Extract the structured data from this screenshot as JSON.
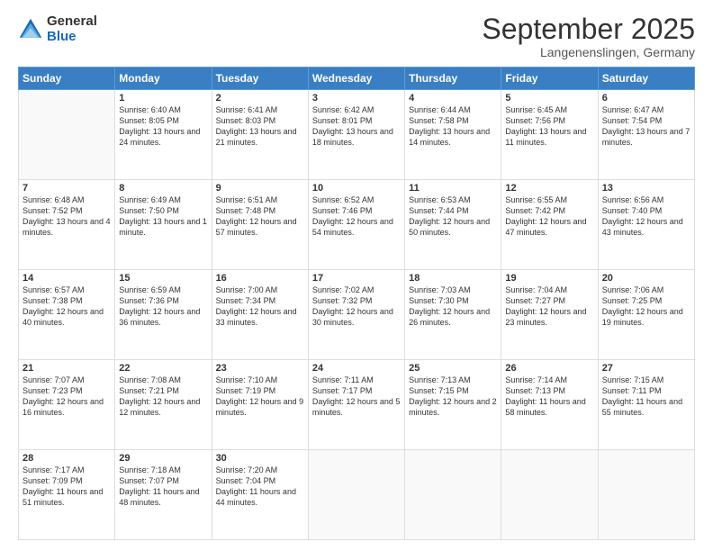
{
  "logo": {
    "general": "General",
    "blue": "Blue"
  },
  "title": "September 2025",
  "location": "Langenenslingen, Germany",
  "days_of_week": [
    "Sunday",
    "Monday",
    "Tuesday",
    "Wednesday",
    "Thursday",
    "Friday",
    "Saturday"
  ],
  "weeks": [
    [
      {
        "day": "",
        "sunrise": "",
        "sunset": "",
        "daylight": ""
      },
      {
        "day": "1",
        "sunrise": "Sunrise: 6:40 AM",
        "sunset": "Sunset: 8:05 PM",
        "daylight": "Daylight: 13 hours and 24 minutes."
      },
      {
        "day": "2",
        "sunrise": "Sunrise: 6:41 AM",
        "sunset": "Sunset: 8:03 PM",
        "daylight": "Daylight: 13 hours and 21 minutes."
      },
      {
        "day": "3",
        "sunrise": "Sunrise: 6:42 AM",
        "sunset": "Sunset: 8:01 PM",
        "daylight": "Daylight: 13 hours and 18 minutes."
      },
      {
        "day": "4",
        "sunrise": "Sunrise: 6:44 AM",
        "sunset": "Sunset: 7:58 PM",
        "daylight": "Daylight: 13 hours and 14 minutes."
      },
      {
        "day": "5",
        "sunrise": "Sunrise: 6:45 AM",
        "sunset": "Sunset: 7:56 PM",
        "daylight": "Daylight: 13 hours and 11 minutes."
      },
      {
        "day": "6",
        "sunrise": "Sunrise: 6:47 AM",
        "sunset": "Sunset: 7:54 PM",
        "daylight": "Daylight: 13 hours and 7 minutes."
      }
    ],
    [
      {
        "day": "7",
        "sunrise": "Sunrise: 6:48 AM",
        "sunset": "Sunset: 7:52 PM",
        "daylight": "Daylight: 13 hours and 4 minutes."
      },
      {
        "day": "8",
        "sunrise": "Sunrise: 6:49 AM",
        "sunset": "Sunset: 7:50 PM",
        "daylight": "Daylight: 13 hours and 1 minute."
      },
      {
        "day": "9",
        "sunrise": "Sunrise: 6:51 AM",
        "sunset": "Sunset: 7:48 PM",
        "daylight": "Daylight: 12 hours and 57 minutes."
      },
      {
        "day": "10",
        "sunrise": "Sunrise: 6:52 AM",
        "sunset": "Sunset: 7:46 PM",
        "daylight": "Daylight: 12 hours and 54 minutes."
      },
      {
        "day": "11",
        "sunrise": "Sunrise: 6:53 AM",
        "sunset": "Sunset: 7:44 PM",
        "daylight": "Daylight: 12 hours and 50 minutes."
      },
      {
        "day": "12",
        "sunrise": "Sunrise: 6:55 AM",
        "sunset": "Sunset: 7:42 PM",
        "daylight": "Daylight: 12 hours and 47 minutes."
      },
      {
        "day": "13",
        "sunrise": "Sunrise: 6:56 AM",
        "sunset": "Sunset: 7:40 PM",
        "daylight": "Daylight: 12 hours and 43 minutes."
      }
    ],
    [
      {
        "day": "14",
        "sunrise": "Sunrise: 6:57 AM",
        "sunset": "Sunset: 7:38 PM",
        "daylight": "Daylight: 12 hours and 40 minutes."
      },
      {
        "day": "15",
        "sunrise": "Sunrise: 6:59 AM",
        "sunset": "Sunset: 7:36 PM",
        "daylight": "Daylight: 12 hours and 36 minutes."
      },
      {
        "day": "16",
        "sunrise": "Sunrise: 7:00 AM",
        "sunset": "Sunset: 7:34 PM",
        "daylight": "Daylight: 12 hours and 33 minutes."
      },
      {
        "day": "17",
        "sunrise": "Sunrise: 7:02 AM",
        "sunset": "Sunset: 7:32 PM",
        "daylight": "Daylight: 12 hours and 30 minutes."
      },
      {
        "day": "18",
        "sunrise": "Sunrise: 7:03 AM",
        "sunset": "Sunset: 7:30 PM",
        "daylight": "Daylight: 12 hours and 26 minutes."
      },
      {
        "day": "19",
        "sunrise": "Sunrise: 7:04 AM",
        "sunset": "Sunset: 7:27 PM",
        "daylight": "Daylight: 12 hours and 23 minutes."
      },
      {
        "day": "20",
        "sunrise": "Sunrise: 7:06 AM",
        "sunset": "Sunset: 7:25 PM",
        "daylight": "Daylight: 12 hours and 19 minutes."
      }
    ],
    [
      {
        "day": "21",
        "sunrise": "Sunrise: 7:07 AM",
        "sunset": "Sunset: 7:23 PM",
        "daylight": "Daylight: 12 hours and 16 minutes."
      },
      {
        "day": "22",
        "sunrise": "Sunrise: 7:08 AM",
        "sunset": "Sunset: 7:21 PM",
        "daylight": "Daylight: 12 hours and 12 minutes."
      },
      {
        "day": "23",
        "sunrise": "Sunrise: 7:10 AM",
        "sunset": "Sunset: 7:19 PM",
        "daylight": "Daylight: 12 hours and 9 minutes."
      },
      {
        "day": "24",
        "sunrise": "Sunrise: 7:11 AM",
        "sunset": "Sunset: 7:17 PM",
        "daylight": "Daylight: 12 hours and 5 minutes."
      },
      {
        "day": "25",
        "sunrise": "Sunrise: 7:13 AM",
        "sunset": "Sunset: 7:15 PM",
        "daylight": "Daylight: 12 hours and 2 minutes."
      },
      {
        "day": "26",
        "sunrise": "Sunrise: 7:14 AM",
        "sunset": "Sunset: 7:13 PM",
        "daylight": "Daylight: 11 hours and 58 minutes."
      },
      {
        "day": "27",
        "sunrise": "Sunrise: 7:15 AM",
        "sunset": "Sunset: 7:11 PM",
        "daylight": "Daylight: 11 hours and 55 minutes."
      }
    ],
    [
      {
        "day": "28",
        "sunrise": "Sunrise: 7:17 AM",
        "sunset": "Sunset: 7:09 PM",
        "daylight": "Daylight: 11 hours and 51 minutes."
      },
      {
        "day": "29",
        "sunrise": "Sunrise: 7:18 AM",
        "sunset": "Sunset: 7:07 PM",
        "daylight": "Daylight: 11 hours and 48 minutes."
      },
      {
        "day": "30",
        "sunrise": "Sunrise: 7:20 AM",
        "sunset": "Sunset: 7:04 PM",
        "daylight": "Daylight: 11 hours and 44 minutes."
      },
      {
        "day": "",
        "sunrise": "",
        "sunset": "",
        "daylight": ""
      },
      {
        "day": "",
        "sunrise": "",
        "sunset": "",
        "daylight": ""
      },
      {
        "day": "",
        "sunrise": "",
        "sunset": "",
        "daylight": ""
      },
      {
        "day": "",
        "sunrise": "",
        "sunset": "",
        "daylight": ""
      }
    ]
  ]
}
